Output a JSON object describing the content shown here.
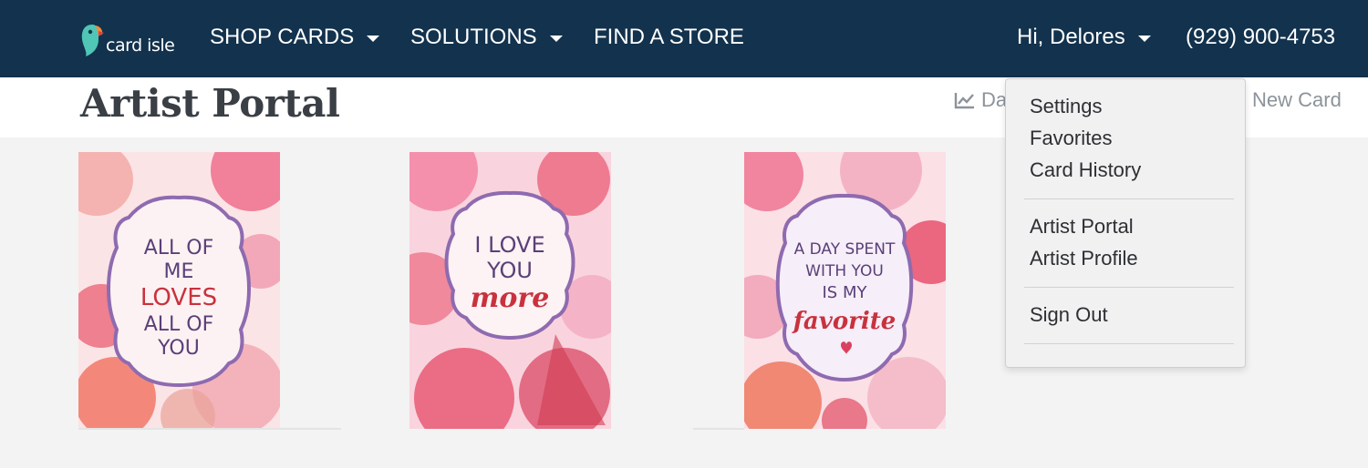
{
  "navbar": {
    "logo_text": "card isle",
    "items": [
      {
        "label": "SHOP CARDS",
        "has_caret": true
      },
      {
        "label": "SOLUTIONS",
        "has_caret": true
      },
      {
        "label": "FIND A STORE",
        "has_caret": false
      }
    ],
    "user_label": "Hi, Delores",
    "phone": "(929) 900-4753",
    "background": "#12324d"
  },
  "page": {
    "title": "Artist Portal",
    "dashboard_label_visible": "Da",
    "new_card_label": "New Card"
  },
  "cards": [
    {
      "line1": "ALL OF",
      "line2": "ME",
      "line3": "LOVES",
      "line4": "ALL OF",
      "line5": "YOU"
    },
    {
      "line1": "I LOVE",
      "line2": "YOU",
      "line3": "more"
    },
    {
      "line1": "A DAY SPENT",
      "line2": "WITH YOU",
      "line3": "IS MY",
      "line4": "favorite"
    }
  ],
  "user_menu": {
    "group1": [
      "Settings",
      "Favorites",
      "Card History"
    ],
    "group2": [
      "Artist Portal",
      "Artist Profile"
    ],
    "group3": [
      "Sign Out"
    ]
  },
  "colors": {
    "navbar": "#12324d",
    "title_text": "#3a3f45",
    "link_gray": "#8c939a",
    "gallery_bg": "#f3f3f3",
    "card_purple": "#5a3f79",
    "card_red": "#c8323d"
  }
}
